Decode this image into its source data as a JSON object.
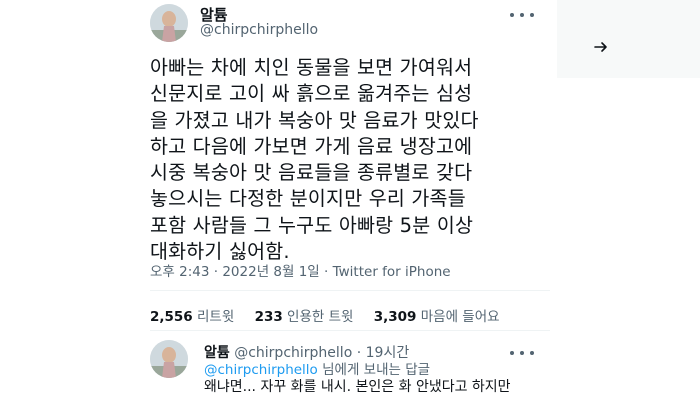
{
  "tweet": {
    "author_name": "알튬",
    "author_handle": "@chirpchirphello",
    "text": "아빠는 차에 치인 동물을 보면 가여워서\n신문지로 고이 싸 흙으로 옮겨주는 심성\n을 가졌고 내가 복숭아 맛 음료가 맛있다\n하고 다음에 가보면 가게 음료 냉장고에\n시중 복숭아 맛  음료들을 종류별로 갖다\n놓으시는 다정한 분이지만 우리 가족들\n포함 사람들 그 누구도 아빠랑 5분 이상\n대화하기 싫어함.",
    "time": "오후 2:43",
    "date": "2022년 8월 1일",
    "source": "Twitter for iPhone",
    "separator": "·"
  },
  "stats": {
    "retweets_count": "2,556",
    "retweets_label": "리트윗",
    "quotes_count": "233",
    "quotes_label": "인용한 트윗",
    "likes_count": "3,309",
    "likes_label": "마음에 들어요"
  },
  "reply": {
    "author_name": "알튬",
    "author_handle": "@chirpchirphello",
    "time": "19시간",
    "separator": "·",
    "replying_to_handle": "@chirpchirphello",
    "replying_suffix": " 님에게 보내는 답글",
    "text": "왜냐면... 자꾸 화를 내시. 본인은 화 안냈다고 하지만"
  },
  "colors": {
    "accent": "#1d9bf0",
    "text_primary": "#0f1419",
    "text_secondary": "#536471"
  },
  "icons": {
    "more": "more-horizontal-icon",
    "arrow": "arrow-right-icon"
  }
}
